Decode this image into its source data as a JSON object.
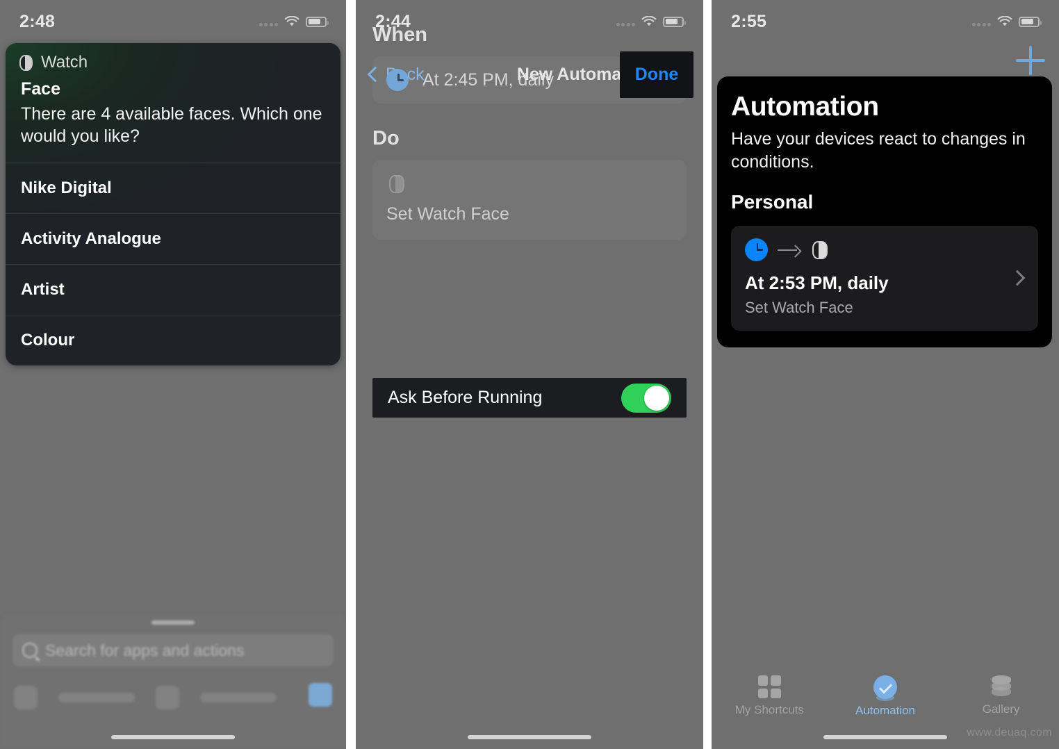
{
  "watermark": "www.deuaq.com",
  "panel1": {
    "status": {
      "time": "2:48"
    },
    "siri_card": {
      "app_name": "Watch",
      "app_icon": "apple-watch-icon",
      "parameter_title": "Face",
      "prompt": "There are 4 available faces. Which one would you like?",
      "options": [
        {
          "label": "Nike Digital"
        },
        {
          "label": "Activity Analogue"
        },
        {
          "label": "Artist"
        },
        {
          "label": "Colour"
        }
      ]
    },
    "sheet": {
      "search_placeholder": "Search for apps and actions",
      "search_icon": "search-icon"
    }
  },
  "panel2": {
    "status": {
      "time": "2:44"
    },
    "nav": {
      "back_label": "Back",
      "back_icon": "chevron-left-icon",
      "title": "New Automation",
      "done_label": "Done"
    },
    "when": {
      "heading": "When",
      "trigger_icon": "clock-icon",
      "trigger_label": "At 2:45 PM, daily"
    },
    "do": {
      "heading": "Do",
      "action_icon": "apple-watch-icon",
      "action_label": "Set Watch Face"
    },
    "ask_before_running": {
      "label": "Ask Before Running",
      "toggle_state": "on",
      "toggle_color": "#2fd158"
    }
  },
  "panel3": {
    "status": {
      "time": "2:55"
    },
    "add_icon": "plus-icon",
    "header": {
      "title": "Automation",
      "subtitle": "Have your devices react to changes in conditions.",
      "group": "Personal"
    },
    "automations": [
      {
        "trigger_icon": "clock-icon",
        "arrow_icon": "arrow-right-icon",
        "action_icon": "apple-watch-icon",
        "title": "At 2:53 PM, daily",
        "subtitle": "Set Watch Face",
        "disclosure_icon": "chevron-right-icon"
      }
    ],
    "tabs": [
      {
        "label": "My Shortcuts",
        "icon": "grid-icon",
        "active": false
      },
      {
        "label": "Automation",
        "icon": "automation-clock-icon",
        "active": true
      },
      {
        "label": "Gallery",
        "icon": "layers-icon",
        "active": false
      }
    ]
  }
}
